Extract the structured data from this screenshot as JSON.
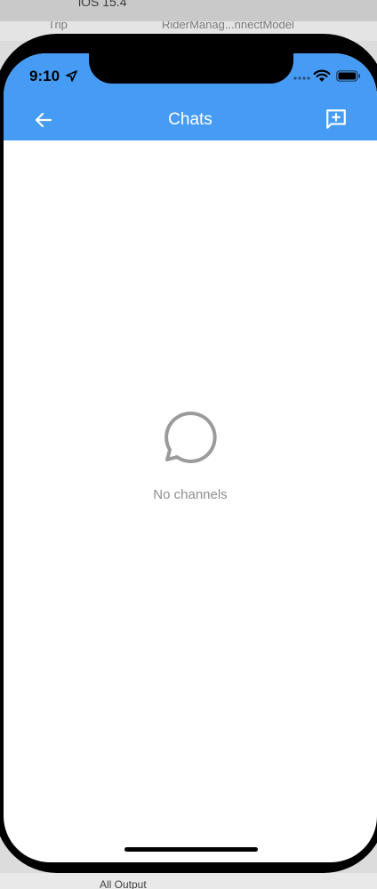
{
  "desktop": {
    "simulator_label": "iOS 15.4",
    "tabs": [
      "Trip",
      "RiderManag...nnectModel"
    ],
    "bottom_text": "All Output"
  },
  "status_bar": {
    "time": "9:10"
  },
  "header": {
    "title": "Chats",
    "background_color": "#469cf5"
  },
  "empty_state": {
    "message": "No channels",
    "icon": "chat-bubble-outline-icon"
  },
  "icons": {
    "back": "arrow-left-icon",
    "new_chat": "add-comment-icon"
  }
}
